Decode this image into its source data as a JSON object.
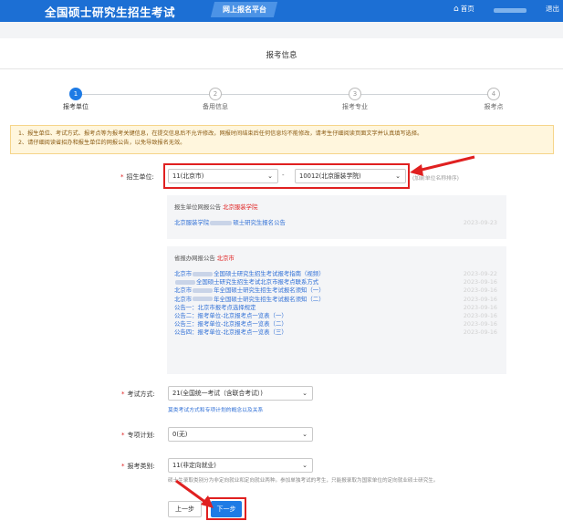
{
  "header": {
    "brand": "全国硕士研究生招生考试",
    "platform": "网上报名平台",
    "home": "首页",
    "logout": "退出"
  },
  "page_title": "报考信息",
  "steps": [
    {
      "num": "1",
      "label": "报考单位",
      "active": true
    },
    {
      "num": "2",
      "label": "备用信息",
      "active": false
    },
    {
      "num": "3",
      "label": "报考专业",
      "active": false
    },
    {
      "num": "4",
      "label": "报考点",
      "active": false
    }
  ],
  "notice": {
    "line1": "1、报生单位、考试方式、报考点等为报考关键信息，在提交信息后不允许修改，网报时间结束后任何信息均不能修改，请考生仔细阅读页面文字并认真填写选择。",
    "line2": "2、请仔细阅读省招办和报生单位的网报公告，以免导致报名无效。"
  },
  "form": {
    "unit_label": "招生单位:",
    "province_value": "11(北京市)",
    "school_value": "10012(北京服装学院)",
    "dash": "-",
    "hint": "(加前单位名称排序)",
    "exam_label": "考试方式:",
    "exam_value": "21(全国统一考试（含联合考试）)",
    "exam_link": "莫类考试方式和专项计划的概念以及关系",
    "plan_label": "专项计划:",
    "plan_value": "0(无)",
    "category_label": "报考类别:",
    "category_value": "11(非定向就业)",
    "category_note": "硕士生录取类别分为非定向就业和定向就业两种。参加单独考试的考生，只能报录取为国家单位的定向就业硕士研究生。"
  },
  "unit_panel": {
    "title": "报生单位网报公告",
    "school": "北京服装学院",
    "rows": [
      {
        "left": "北京服装学院",
        "right": "硕士研究生报名公告",
        "date": "2023-09-23"
      }
    ]
  },
  "office_panel": {
    "title": "省报办网报公告",
    "city": "北京市",
    "rows": [
      {
        "pre": "北京市",
        "blur": true,
        "text": "全国硕士研究生招生考试报考指南（视频）",
        "date": "2023-09-22"
      },
      {
        "pre": "",
        "blur": true,
        "text": "全国硕士研究生招生考试北京市报考点联系方式",
        "date": "2023-09-16"
      },
      {
        "pre": "北京市",
        "blur": true,
        "text": "年全国硕士研究生招生考试报名须知（一）",
        "date": "2023-09-16"
      },
      {
        "pre": "北京市",
        "blur": true,
        "text": "年全国硕士研究生招生考试报名须知（二）",
        "date": "2023-09-16"
      },
      {
        "pre": "",
        "blur": false,
        "text": "公告一：北京市报考点选择规定",
        "date": "2023-09-16"
      },
      {
        "pre": "",
        "blur": false,
        "text": "公告二：报考单位-北京报考点一览表（一）",
        "date": "2023-09-16"
      },
      {
        "pre": "",
        "blur": false,
        "text": "公告三：报考单位-北京报考点一览表（二）",
        "date": "2023-09-16"
      },
      {
        "pre": "",
        "blur": false,
        "text": "公告四：报考单位-北京报考点一览表（三）",
        "date": "2023-09-16"
      }
    ]
  },
  "buttons": {
    "prev": "上一步",
    "next": "下一步"
  },
  "colors": {
    "header_blue": "#1c6fd4",
    "accent_blue": "#1e7be5",
    "highlight_red": "#e02020",
    "notice_bg": "#fff6dd"
  }
}
